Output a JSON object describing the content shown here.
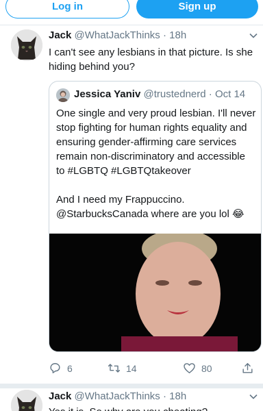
{
  "header": {
    "login_label": "Log in",
    "signup_label": "Sign up"
  },
  "tweets": [
    {
      "name": "Jack",
      "handle": "@WhatJackThinks",
      "separator": "·",
      "time": "18h",
      "text": "I can't see any lesbians in that picture. Is she hiding behind you?",
      "quote": {
        "name": "Jessica Yaniv",
        "handle": "@trustednerd",
        "separator": "·",
        "date": "Oct 14",
        "paragraph1": "One single and very proud lesbian. I'll never stop fighting for human rights equality and ensuring gender-affirming care services remain non-discriminatory and accessible to #LGBTQ #LGBTQtakeover",
        "paragraph2": "And I need my Frappuccino. @StarbucksCanada where are you lol 😂"
      },
      "actions": {
        "reply_count": "6",
        "retweet_count": "14",
        "like_count": "80"
      }
    },
    {
      "name": "Jack",
      "handle": "@WhatJackThinks",
      "separator": "·",
      "time": "18h",
      "text": "Yes it is. So why are you cheating?"
    }
  ],
  "icons": {
    "reply": "reply-icon",
    "retweet": "retweet-icon",
    "like": "heart-icon",
    "share": "share-icon",
    "more": "chevron-down-icon"
  },
  "colors": {
    "accent": "#1da1f2",
    "text": "#14171a",
    "secondary": "#657786",
    "border": "#ccd6dd"
  }
}
